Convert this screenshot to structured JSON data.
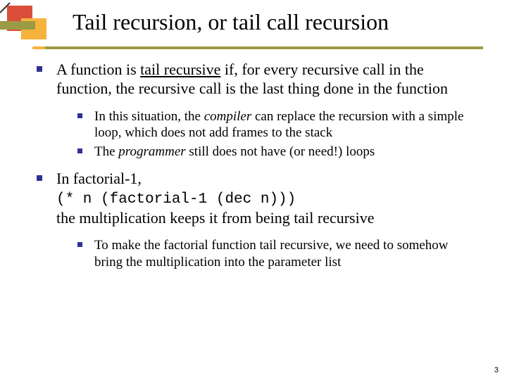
{
  "title": "Tail recursion, or tail call recursion",
  "b1": {
    "pre": "A function is ",
    "ul": "tail recursive",
    "post": " if, for every recursive call in the function, the recursive call is the last thing done in the function",
    "sub": {
      "s1a": "In this situation, the ",
      "s1b": "compiler",
      "s1c": " can replace the recursion with a simple loop, which does not add frames to the stack",
      "s2a": "The ",
      "s2b": "programmer",
      "s2c": " still does not have (or need!) loops"
    }
  },
  "b2": {
    "l1": "In factorial-1,",
    "code": "(* n (factorial-1 (dec n)))",
    "l3": "the multiplication keeps it from being tail recursive",
    "sub": {
      "s1": "To make the factorial function tail recursive, we need to somehow bring the multiplication into the parameter list"
    }
  },
  "page_number": "3"
}
